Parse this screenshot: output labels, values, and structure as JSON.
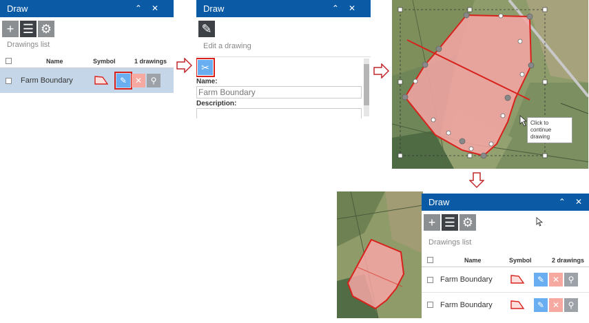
{
  "panel1": {
    "title": "Draw",
    "collapse_icon": "double-chevron-up-icon",
    "close_icon": "close-icon",
    "toolbar": [
      "add-icon",
      "list-icon",
      "gear-icon"
    ],
    "list_caption": "Drawings list",
    "columns": {
      "name": "Name",
      "symbol": "Symbol",
      "count": "1 drawings"
    },
    "rows": [
      {
        "name": "Farm Boundary"
      }
    ]
  },
  "panel2": {
    "title": "Draw",
    "section_caption": "Edit a drawing",
    "name_label": "Name:",
    "name_value": "Farm Boundary",
    "description_label": "Description:",
    "tool_icon": "scissors-icon"
  },
  "map1": {
    "tooltip": "Click to continue drawing"
  },
  "panel3": {
    "title": "Draw",
    "list_caption": "Drawings list",
    "columns": {
      "name": "Name",
      "symbol": "Symbol",
      "count": "2 drawings"
    },
    "rows": [
      {
        "name": "Farm Boundary"
      },
      {
        "name": "Farm Boundary"
      }
    ]
  },
  "colors": {
    "titlebar": "#0a5aa6",
    "highlight": "#d9211b",
    "polygon_fill": "#f6a6a6",
    "selected_row": "#c5d6e8"
  }
}
